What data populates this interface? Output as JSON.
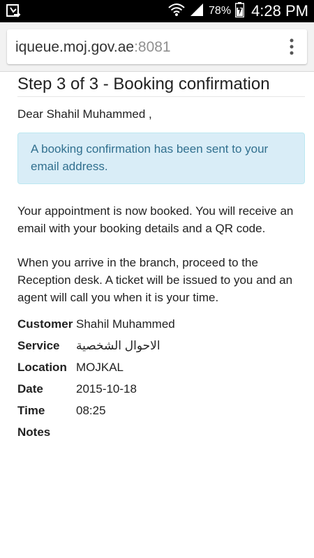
{
  "status_bar": {
    "battery_percent": "78%",
    "time": "4:28 PM"
  },
  "browser": {
    "url_host": "iqueue.moj.gov.ae",
    "url_port": ":8081"
  },
  "page": {
    "title": "Step 3 of 3 - Booking confirmation",
    "greeting": "Dear Shahil Muhammed ,",
    "alert": "A booking confirmation has been sent to your email address.",
    "paragraph1": "Your appointment is now booked. You will receive an email with your booking details and a QR code.",
    "paragraph2": "When you arrive in the branch, proceed to the Reception desk. A ticket will be issued to you and an agent will call you when it is your time."
  },
  "details": [
    {
      "label": "Customer",
      "value": "Shahil Muhammed"
    },
    {
      "label": "Service",
      "value": "الاحوال الشخصية"
    },
    {
      "label": "Location",
      "value": "MOJKAL"
    },
    {
      "label": "Date",
      "value": "2015-10-18"
    },
    {
      "label": "Time",
      "value": "08:25"
    },
    {
      "label": "Notes",
      "value": ""
    }
  ]
}
